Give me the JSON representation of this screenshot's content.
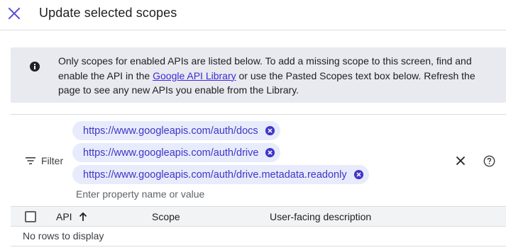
{
  "header": {
    "title": "Update selected scopes",
    "close_icon": "close-icon"
  },
  "info": {
    "icon": "info-icon",
    "text_before_link": "Only scopes for enabled APIs are listed below. To add a missing scope to this screen, find and enable the API in the ",
    "link_text": "Google API Library",
    "text_after_link": " or use the Pasted Scopes text box below. Refresh the page to see any new APIs you enable from the Library."
  },
  "filter": {
    "label": "Filter",
    "chips": [
      "https://www.googleapis.com/auth/docs",
      "https://www.googleapis.com/auth/drive",
      "https://www.googleapis.com/auth/drive.metadata.readonly"
    ],
    "placeholder": "Enter property name or value"
  },
  "table": {
    "columns": {
      "api": "API",
      "scope": "Scope",
      "description": "User-facing description"
    },
    "sort": "ascending",
    "empty_message": "No rows to display"
  },
  "colors": {
    "accent": "#3c2bd6",
    "chip_bg": "#e8ebfb",
    "info_bg": "#e8eaf0"
  }
}
